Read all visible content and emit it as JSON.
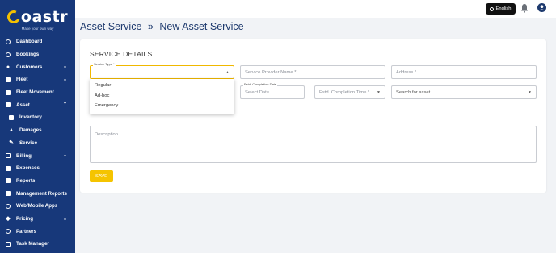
{
  "brand": {
    "name": "oastr",
    "tagline": "Make your own way"
  },
  "sidebar": {
    "items": [
      {
        "label": "Dashboard",
        "icon": "dashboard-icon"
      },
      {
        "label": "Bookings",
        "icon": "bookings-icon"
      },
      {
        "label": "Customers",
        "icon": "customers-icon",
        "expand": "⌄"
      },
      {
        "label": "Fleet",
        "icon": "fleet-icon",
        "expand": "⌄"
      },
      {
        "label": "Fleet Movement",
        "icon": "fleet-movement-icon"
      },
      {
        "label": "Asset",
        "icon": "asset-icon",
        "expand": "⌃"
      },
      {
        "label": "Inventory",
        "icon": "inventory-icon"
      },
      {
        "label": "Damages",
        "icon": "damages-icon"
      },
      {
        "label": "Service",
        "icon": "service-icon"
      },
      {
        "label": "Billing",
        "icon": "billing-icon",
        "expand": "⌄"
      },
      {
        "label": "Expenses",
        "icon": "expenses-icon"
      },
      {
        "label": "Reports",
        "icon": "reports-icon"
      },
      {
        "label": "Management Reports",
        "icon": "management-reports-icon"
      },
      {
        "label": "Web/Mobile Apps",
        "icon": "globe-icon"
      },
      {
        "label": "Pricing",
        "icon": "pricing-icon",
        "expand": "⌄"
      },
      {
        "label": "Partners",
        "icon": "partners-icon"
      },
      {
        "label": "Task Manager",
        "icon": "task-manager-icon"
      }
    ]
  },
  "topbar": {
    "language": "English"
  },
  "page": {
    "breadcrumb_parent": "Asset Service",
    "separator": "»",
    "breadcrumb_current": "New Asset Service",
    "section_title": "SERVICE DETAILS"
  },
  "form": {
    "service_type": {
      "label": "Service Type *",
      "value": ""
    },
    "service_type_options": [
      "Regular",
      "Ad-hoc",
      "Emergency"
    ],
    "provider_name": {
      "placeholder": "Service Provider Name *"
    },
    "address": {
      "placeholder": "Address *"
    },
    "completion_date": {
      "label": "Estd. Completion Date",
      "placeholder": "Select Date"
    },
    "completion_time": {
      "placeholder": "Estd. Completion Time *"
    },
    "asset_search": {
      "placeholder": "Search for asset"
    },
    "description": {
      "placeholder": "Description"
    },
    "save_label": "SAVE"
  },
  "colors": {
    "sidebar_bg": "#17387a",
    "accent": "#f5c400",
    "title": "#1e3a6e"
  }
}
